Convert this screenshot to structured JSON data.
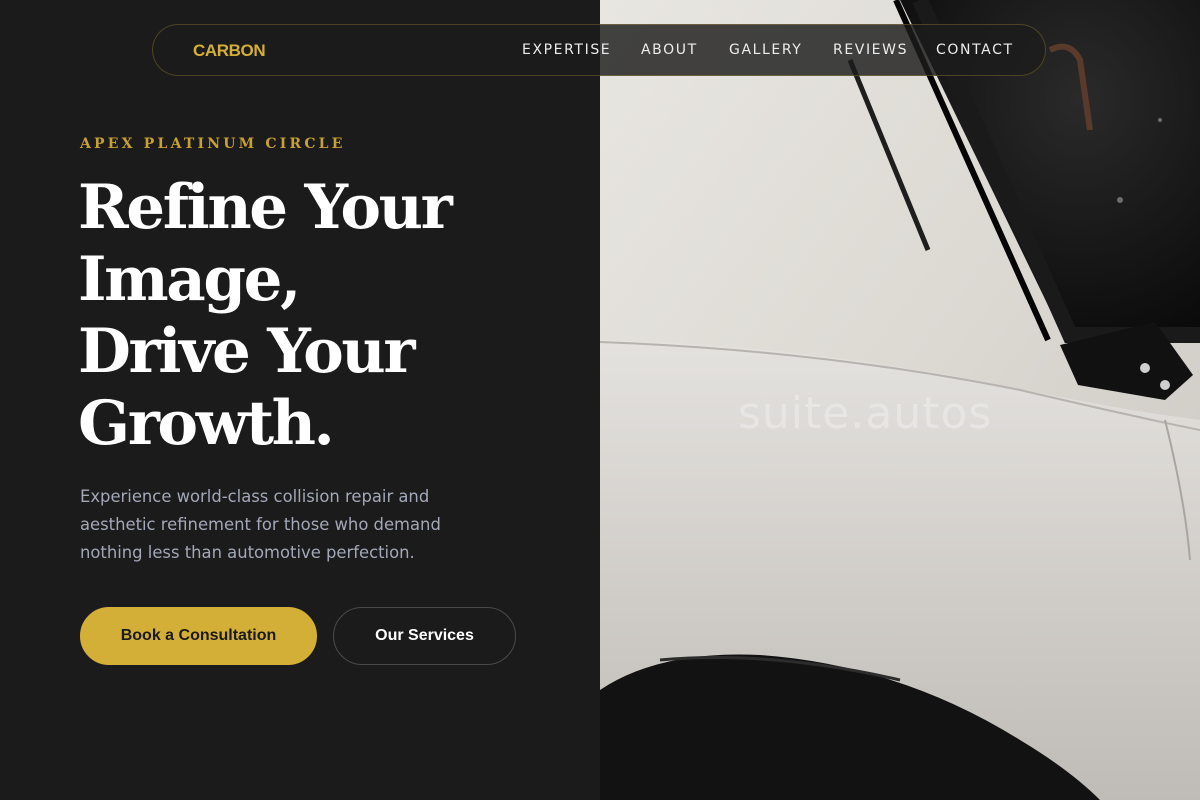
{
  "brand": {
    "name": "CARBON"
  },
  "nav": {
    "items": [
      {
        "label": "EXPERTISE"
      },
      {
        "label": "ABOUT"
      },
      {
        "label": "GALLERY"
      },
      {
        "label": "REVIEWS"
      },
      {
        "label": "CONTACT"
      }
    ]
  },
  "hero": {
    "eyebrow": "APEX PLATINUM CIRCLE",
    "headline_lines": [
      "Refine Your",
      "Image,",
      "Drive Your",
      "Growth."
    ],
    "subtext": "Experience world-class collision repair and aesthetic refinement for those who demand nothing less than automotive perfection.",
    "primary_cta": "Book a Consultation",
    "secondary_cta": "Our Services"
  },
  "photo": {
    "watermark": "suite.autos"
  },
  "colors": {
    "accent": "#d4af37",
    "background": "#1b1b1b",
    "text": "#ffffff",
    "muted_text": "#a3a8b8"
  }
}
